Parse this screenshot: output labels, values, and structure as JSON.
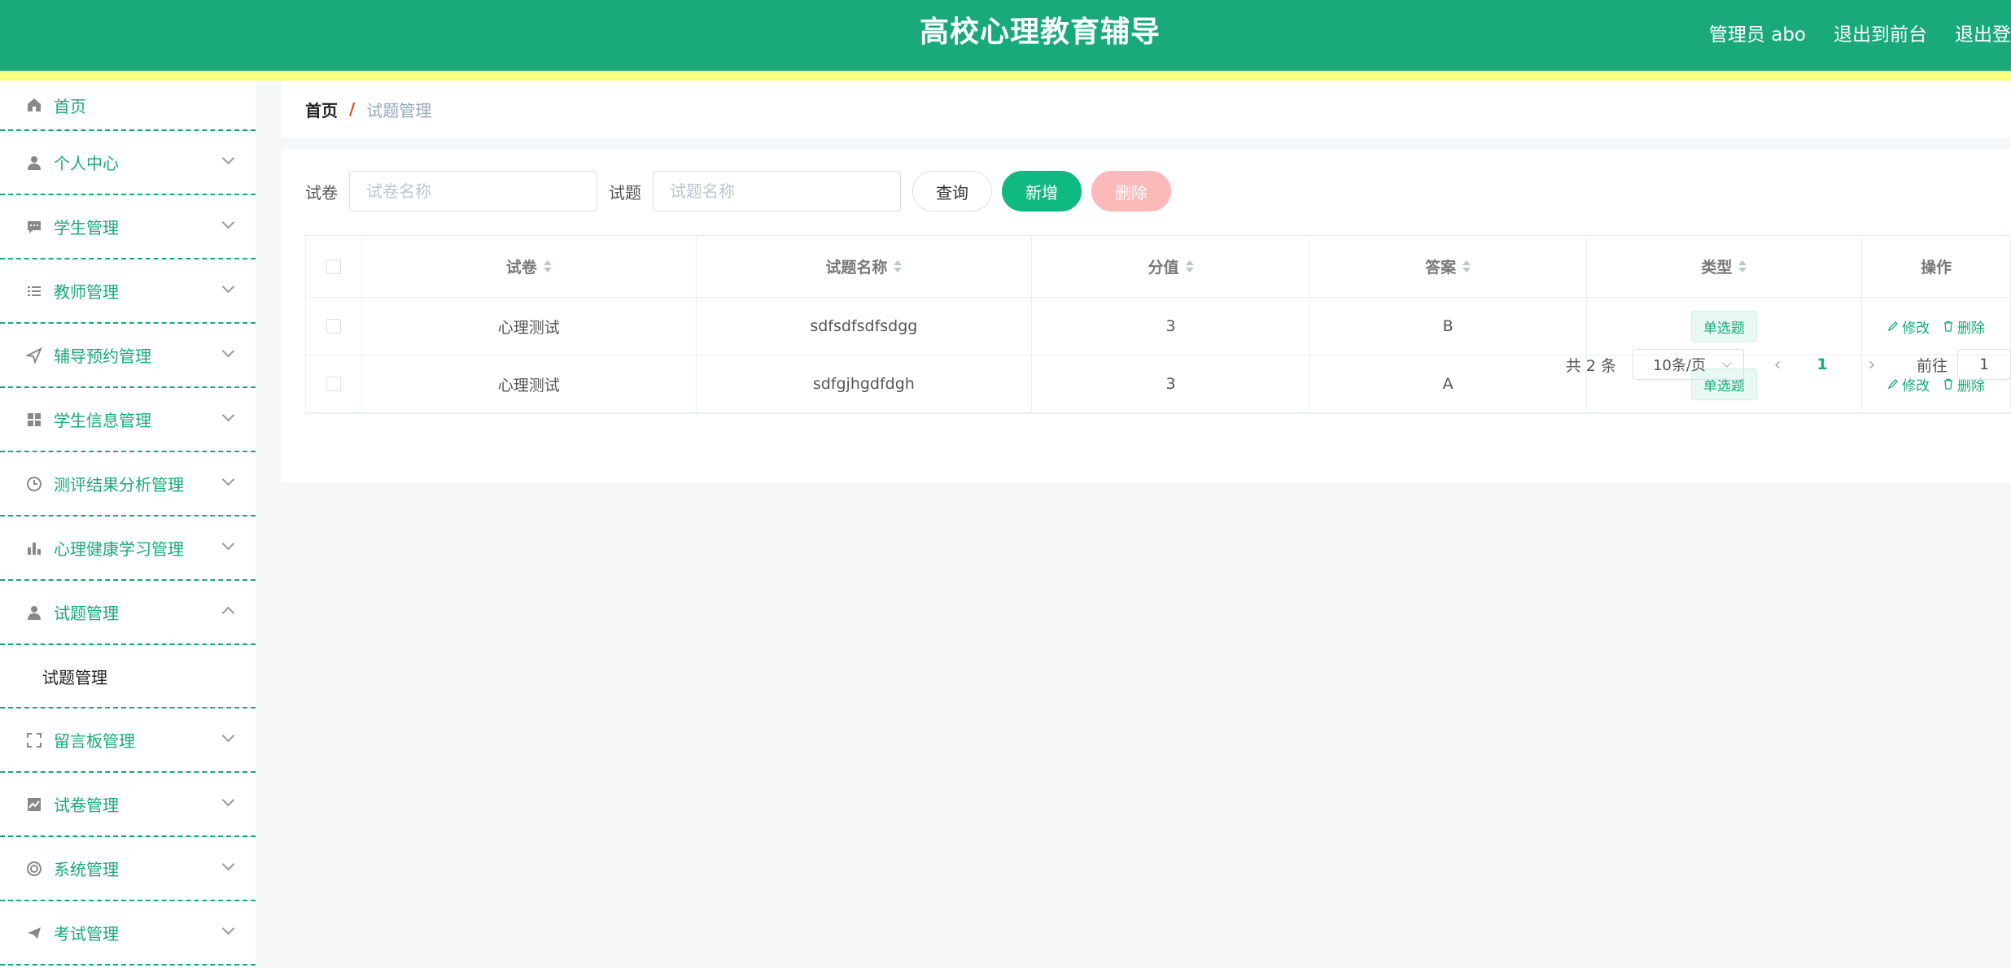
{
  "header": {
    "title": "高校心理教育辅导",
    "user": "管理员 abo",
    "exit_front": "退出到前台",
    "logout": "退出登"
  },
  "sidebar": {
    "items": [
      {
        "label": "首页",
        "icon": "home-icon"
      },
      {
        "label": "个人中心",
        "icon": "user-icon"
      },
      {
        "label": "学生管理",
        "icon": "chat-icon"
      },
      {
        "label": "教师管理",
        "icon": "list-icon"
      },
      {
        "label": "辅导预约管理",
        "icon": "send-icon"
      },
      {
        "label": "学生信息管理",
        "icon": "grid-icon"
      },
      {
        "label": "测评结果分析管理",
        "icon": "clock-icon"
      },
      {
        "label": "心理健康学习管理",
        "icon": "bar-chart-icon"
      },
      {
        "label": "试题管理",
        "icon": "user-icon"
      },
      {
        "label": "留言板管理",
        "icon": "fullscreen-icon"
      },
      {
        "label": "试卷管理",
        "icon": "line-chart-icon"
      },
      {
        "label": "系统管理",
        "icon": "lifebuoy-icon"
      },
      {
        "label": "考试管理",
        "icon": "paper-plane-icon"
      }
    ],
    "submenu": {
      "label": "试题管理"
    }
  },
  "breadcrumb": {
    "home": "首页",
    "sep": "/",
    "current": "试题管理"
  },
  "search": {
    "paper_label": "试卷",
    "paper_placeholder": "试卷名称",
    "question_label": "试题",
    "question_placeholder": "试题名称",
    "query_btn": "查询",
    "add_btn": "新增",
    "delete_btn": "删除"
  },
  "table": {
    "columns": [
      "试卷",
      "试题名称",
      "分值",
      "答案",
      "类型",
      "操作"
    ],
    "rows": [
      {
        "paper": "心理测试",
        "name": "sdfsdfsdfsdgg",
        "score": "3",
        "answer": "B",
        "type": "单选题",
        "edit": "修改",
        "delete": "删除"
      },
      {
        "paper": "心理测试",
        "name": "sdfgjhgdfdgh",
        "score": "3",
        "answer": "A",
        "type": "单选题",
        "edit": "修改",
        "delete": "删除"
      }
    ]
  },
  "pagination": {
    "total": "共 2 条",
    "page_size": "10条/页",
    "prev": "‹",
    "current": "1",
    "next": "›",
    "goto_label": "前往",
    "goto_value": "1"
  },
  "colors": {
    "primary": "#1aa97b",
    "accent_bar": "#f7ff7d",
    "add": "#10b981",
    "delete": "#fbb9b9"
  }
}
